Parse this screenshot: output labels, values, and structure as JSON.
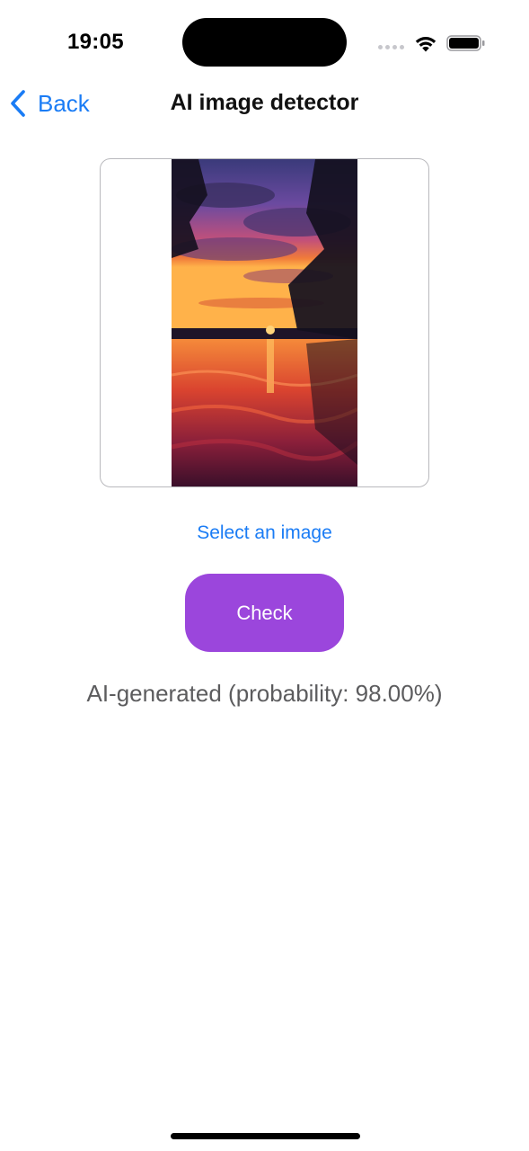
{
  "status_bar": {
    "time": "19:05"
  },
  "nav": {
    "back_label": "Back",
    "title": "AI image detector"
  },
  "image_picker": {
    "select_label": "Select an image"
  },
  "actions": {
    "check_label": "Check"
  },
  "result": {
    "text": "AI-generated (probability: 98.00%)"
  },
  "colors": {
    "accent_blue": "#1a7cf5",
    "button_purple": "#9b46dc",
    "result_text": "#5c5c5e"
  },
  "icons": {
    "back": "chevron-left-icon",
    "wifi": "wifi-icon",
    "battery": "battery-icon",
    "signal": "cellular-signal-icon"
  }
}
